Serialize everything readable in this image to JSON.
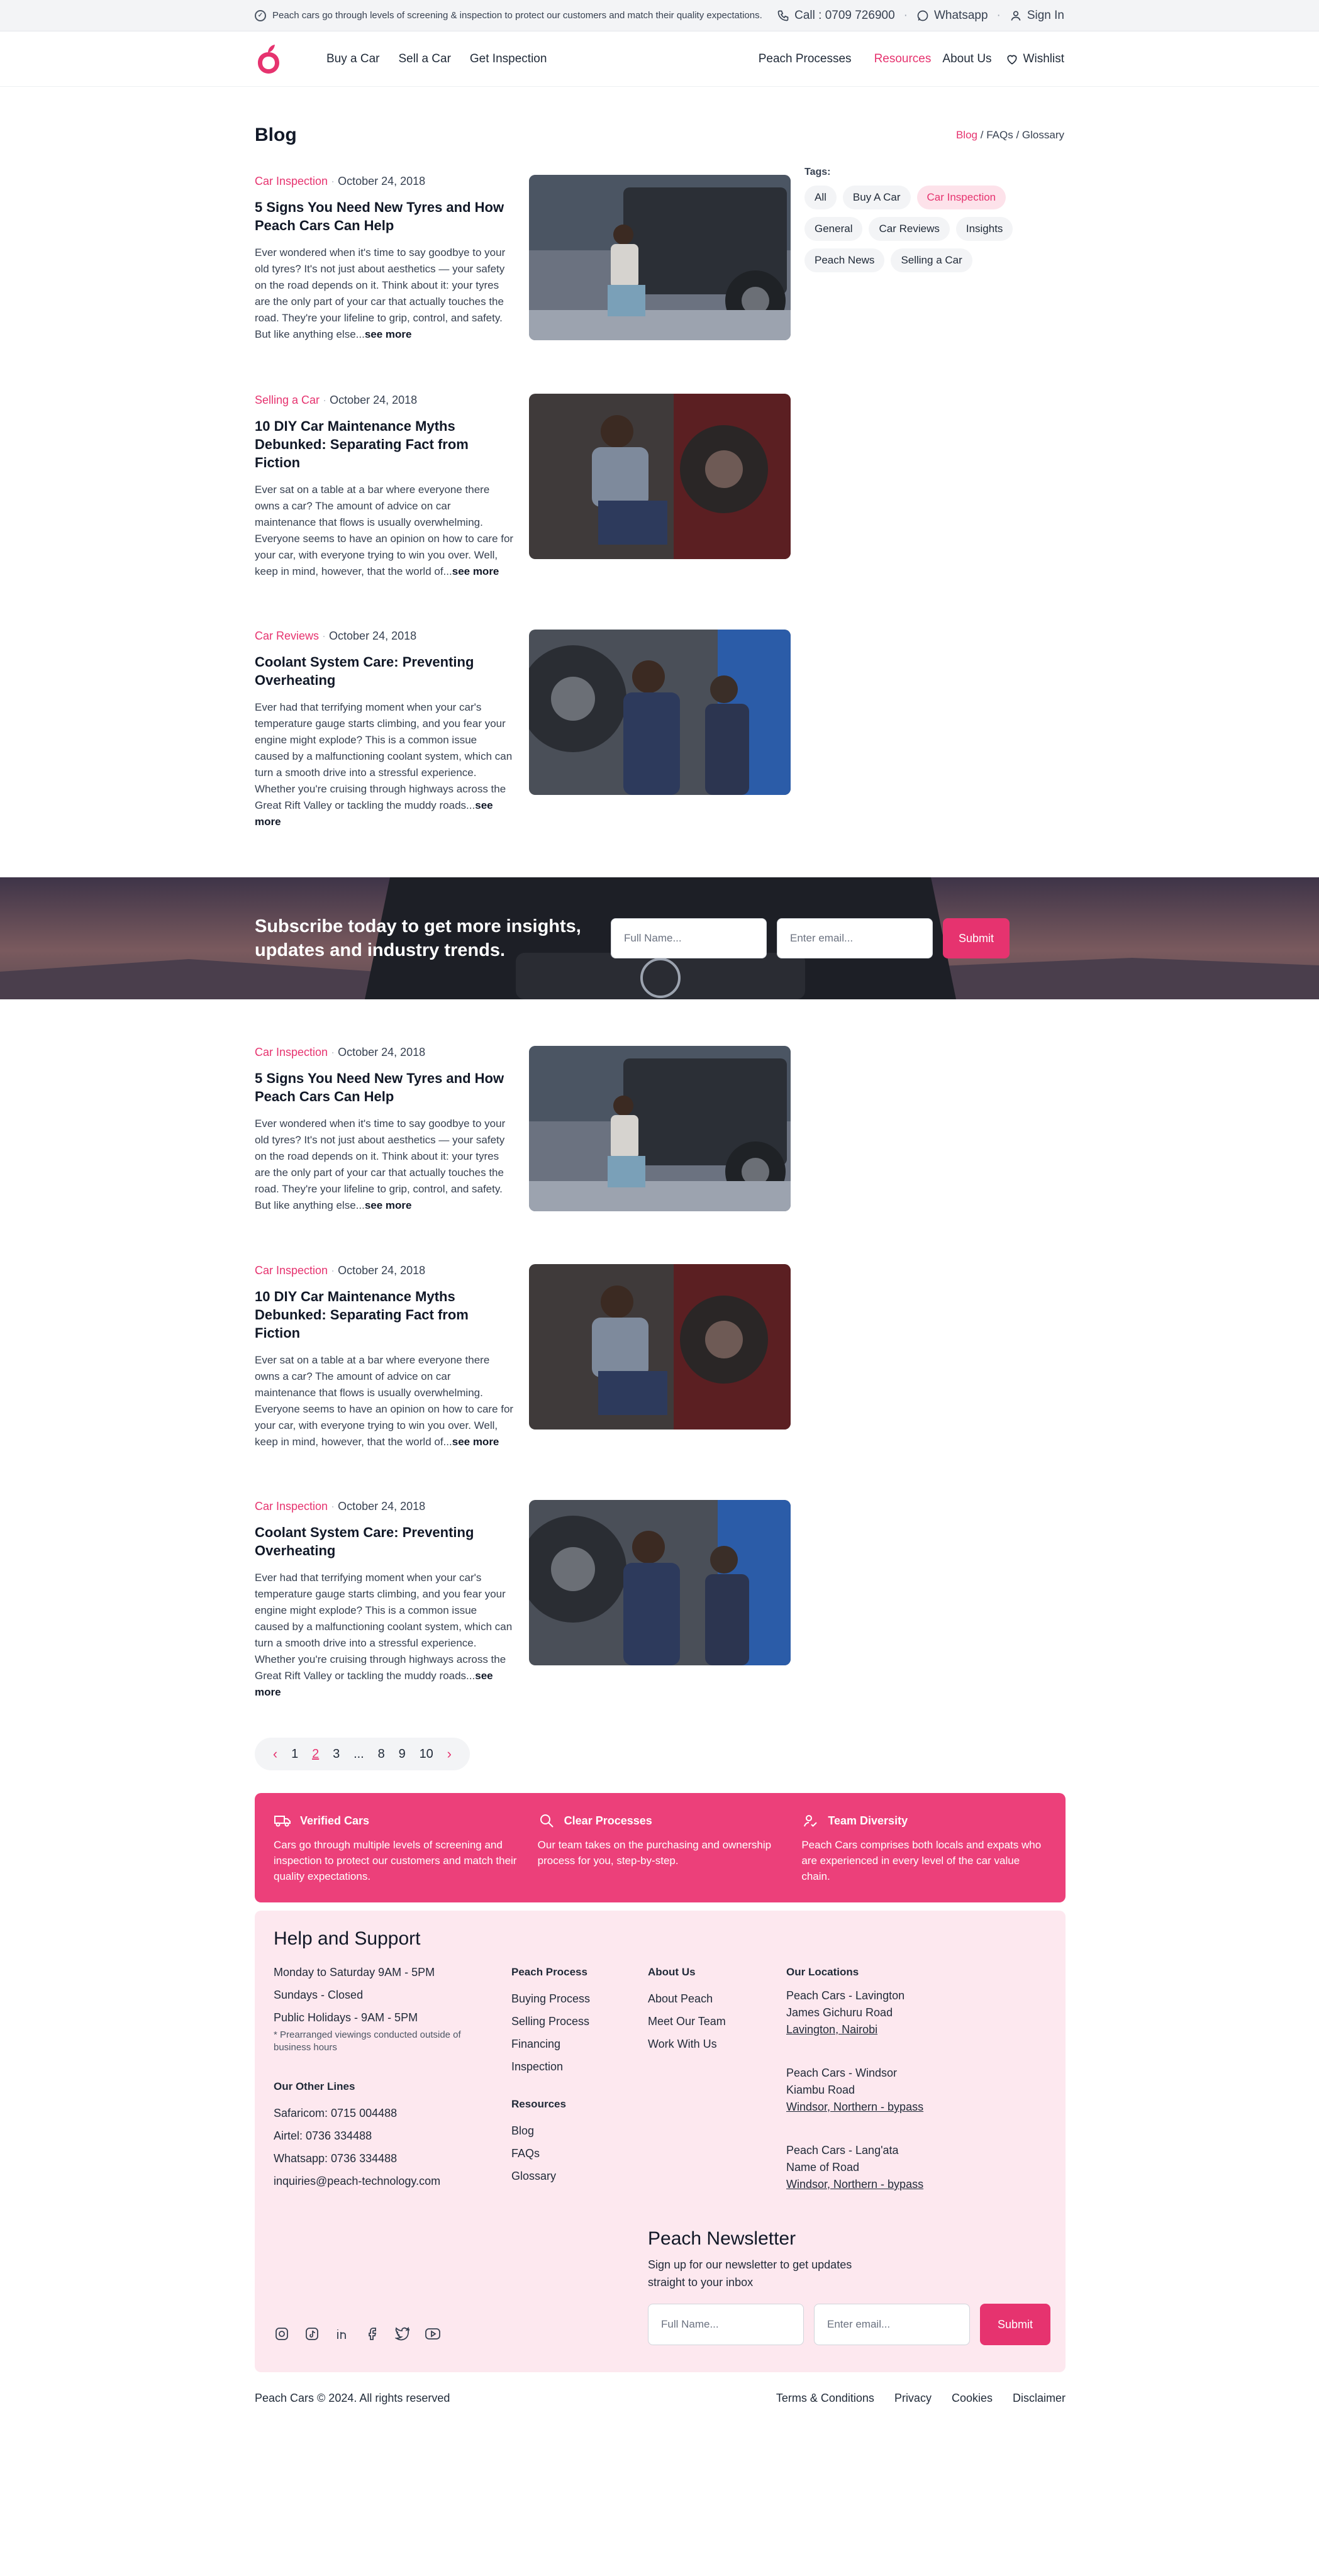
{
  "topbar": {
    "notice": "Peach cars go through levels of screening & inspection to protect our customers and match their quality expectations.",
    "call": "Call : 0709 726900",
    "whatsapp": "Whatsapp",
    "signin": "Sign In"
  },
  "nav": {
    "buy": "Buy a Car",
    "sell": "Sell a Car",
    "inspection": "Get Inspection",
    "processes": "Peach Processes",
    "resources": "Resources",
    "about": "About Us",
    "wishlist": "Wishlist"
  },
  "page": {
    "title": "Blog",
    "crumb_blog": "Blog",
    "crumb_sep": "/",
    "crumb_faqs": "FAQs",
    "crumb_glossary": "Glossary"
  },
  "tags": {
    "label": "Tags:",
    "items": [
      "All",
      "Buy A Car",
      "Car Inspection",
      "General",
      "Car Reviews",
      "Insights",
      "Peach News",
      "Selling a Car"
    ]
  },
  "articles": [
    {
      "category": "Car Inspection",
      "date": "October 24, 2018",
      "title": "5 Signs You Need New Tyres and How Peach Cars Can Help",
      "body": "Ever wondered when it's time to say goodbye to your old tyres? It's not just about aesthetics — your safety on the road depends on it.  Think about it: your tyres are the only part of your car that actually touches the road. They're your lifeline to grip, control, and safety. But like anything else...",
      "more": "see more"
    },
    {
      "category": "Selling a Car",
      "date": "October 24, 2018",
      "title": "10 DIY Car Maintenance Myths Debunked: Separating Fact from Fiction",
      "body": "Ever sat on a table at a bar where everyone there owns a car? The amount of advice on car maintenance that flows is usually overwhelming. Everyone seems to have an opinion on how to care for your car, with everyone trying to win you over. Well, keep in mind, however, that the world of...",
      "more": "see more"
    },
    {
      "category": "Car Reviews",
      "date": "October 24, 2018",
      "title": "Coolant System Care: Preventing Overheating",
      "body": "Ever had that terrifying moment when your car's temperature gauge starts climbing, and you fear your engine might explode? This is a common issue caused by a malfunctioning coolant system, which can turn a smooth drive into a stressful experience.  Whether you're cruising through highways across the Great Rift Valley or tackling the muddy roads...",
      "more": "see more"
    },
    {
      "category": "Car Inspection",
      "date": "October 24, 2018",
      "title": "5 Signs You Need New Tyres and How Peach Cars Can Help",
      "body": "Ever wondered when it's time to say goodbye to your old tyres? It's not just about aesthetics — your safety on the road depends on it.  Think about it: your tyres are the only part of your car that actually touches the road. They're your lifeline to grip, control, and safety. But like anything else...",
      "more": "see more"
    },
    {
      "category": "Car Inspection",
      "date": "October 24, 2018",
      "title": "10 DIY Car Maintenance Myths Debunked: Separating Fact from Fiction",
      "body": "Ever sat on a table at a bar where everyone there owns a car? The amount of advice on car maintenance that flows is usually overwhelming. Everyone seems to have an opinion on how to care for your car, with everyone trying to win you over. Well, keep in mind, however, that the world of...",
      "more": "see more"
    },
    {
      "category": "Car Inspection",
      "date": "October 24, 2018",
      "title": "Coolant System Care: Preventing Overheating",
      "body": "Ever had that terrifying moment when your car's temperature gauge starts climbing, and you fear your engine might explode? This is a common issue caused by a malfunctioning coolant system, which can turn a smooth drive into a stressful experience.  Whether you're cruising through highways across the Great Rift Valley or tackling the muddy roads...",
      "more": "see more"
    }
  ],
  "subscribe": {
    "heading": "Subscribe today to get more insights, updates and industry trends.",
    "name_placeholder": "Full Name...",
    "email_placeholder": "Enter email...",
    "submit": "Submit"
  },
  "pagination": {
    "pages": [
      "1",
      "2",
      "3",
      "...",
      "8",
      "9",
      "10"
    ],
    "current": "2"
  },
  "features": [
    {
      "title": "Verified Cars",
      "body": "Cars go through multiple levels of screening and inspection to protect our customers and match their quality expectations."
    },
    {
      "title": "Clear Processes",
      "body": "Our team takes on the purchasing and ownership process for you, step-by-step."
    },
    {
      "title": "Team Diversity",
      "body": "Peach Cars comprises both locals and expats who are experienced in every level of the car value chain."
    }
  ],
  "footer": {
    "title": "Help and Support",
    "hours": [
      "Monday to Saturday 9AM - 5PM",
      "Sundays - Closed",
      "Public Holidays - 9AM - 5PM"
    ],
    "hours_note": "* Prearranged viewings conducted outside of business hours",
    "other_lines_title": "Our Other Lines",
    "other_lines": [
      "Safaricom: 0715 004488",
      "Airtel: 0736 334488",
      "Whatsapp: 0736 334488",
      "inquiries@peach-technology.com"
    ],
    "process_title": "Peach Process",
    "process_items": [
      "Buying Process",
      "Selling Process",
      "Financing",
      "Inspection"
    ],
    "resources_title": "Resources",
    "resources_items": [
      "Blog",
      "FAQs",
      "Glossary"
    ],
    "about_title": "About Us",
    "about_items": [
      "About Peach",
      "Meet Our Team",
      "Work With Us"
    ],
    "locations_title": "Our Locations",
    "locations": [
      {
        "name": "Peach Cars - Lavington",
        "road": "James Gichuru Road",
        "area": "Lavington, Nairobi"
      },
      {
        "name": "Peach Cars - Windsor",
        "road": "Kiambu Road",
        "area": "Windsor, Northern - bypass"
      },
      {
        "name": "Peach Cars - Lang'ata",
        "road": "Name of Road",
        "area": "Windsor, Northern - bypass"
      }
    ],
    "newsletter_title": "Peach Newsletter",
    "newsletter_desc": "Sign up for our newsletter to get updates straight to your inbox",
    "name_placeholder": "Full Name...",
    "email_placeholder": "Enter email...",
    "submit": "Submit"
  },
  "bottom": {
    "copyright": "Peach Cars © 2024. All rights reserved",
    "terms": "Terms & Conditions",
    "privacy": "Privacy",
    "cookies": "Cookies",
    "disclaimer": "Disclaimer"
  },
  "colors": {
    "accent": "#e6336f",
    "feature_bg": "#ec407a",
    "footer_bg": "#fde8ef"
  }
}
